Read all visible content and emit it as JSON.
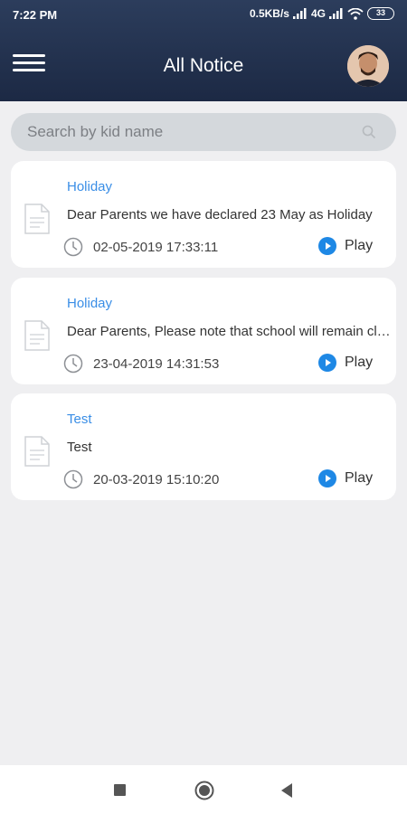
{
  "status": {
    "time": "7:22 PM",
    "speed": "0.5KB/s",
    "network": "4G",
    "battery": "33"
  },
  "header": {
    "title": "All Notice"
  },
  "search": {
    "placeholder": "Search by kid name"
  },
  "notices": [
    {
      "category": "Holiday",
      "message": "Dear Parents we have declared 23 May as Holiday",
      "datetime": "02-05-2019 17:33:11",
      "play_label": "Play"
    },
    {
      "category": "Holiday",
      "message": "Dear Parents,  Please note that school will remain closed",
      "datetime": "23-04-2019 14:31:53",
      "play_label": "Play"
    },
    {
      "category": "Test",
      "message": "Test",
      "datetime": "20-03-2019 15:10:20",
      "play_label": "Play"
    }
  ],
  "colors": {
    "header_bg": "#1f2d49",
    "accent": "#3a8ee6",
    "play_button": "#1e88e5"
  },
  "icons": {
    "menu": "hamburger-icon",
    "search": "search-icon",
    "document": "document-icon",
    "clock": "clock-icon",
    "play": "play-circle-icon"
  }
}
